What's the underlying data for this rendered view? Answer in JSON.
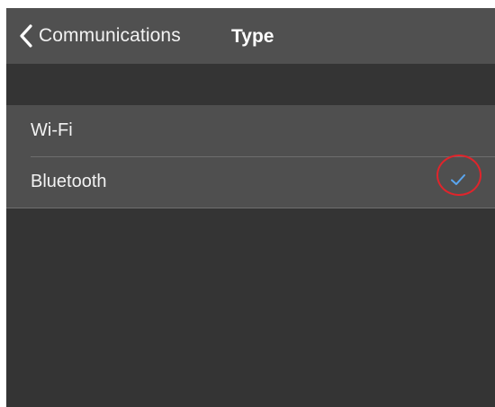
{
  "nav": {
    "back_label": "Communications",
    "title": "Type"
  },
  "options": [
    {
      "label": "Wi-Fi",
      "selected": false
    },
    {
      "label": "Bluetooth",
      "selected": true
    }
  ],
  "colors": {
    "nav_background": "#505050",
    "screen_background": "#343434",
    "list_background": "#4f4f4f",
    "checkmark": "#5aa6f0",
    "annotation_circle": "#e0242b"
  },
  "icons": {
    "back": "chevron-left-icon",
    "selected": "checkmark-icon"
  }
}
